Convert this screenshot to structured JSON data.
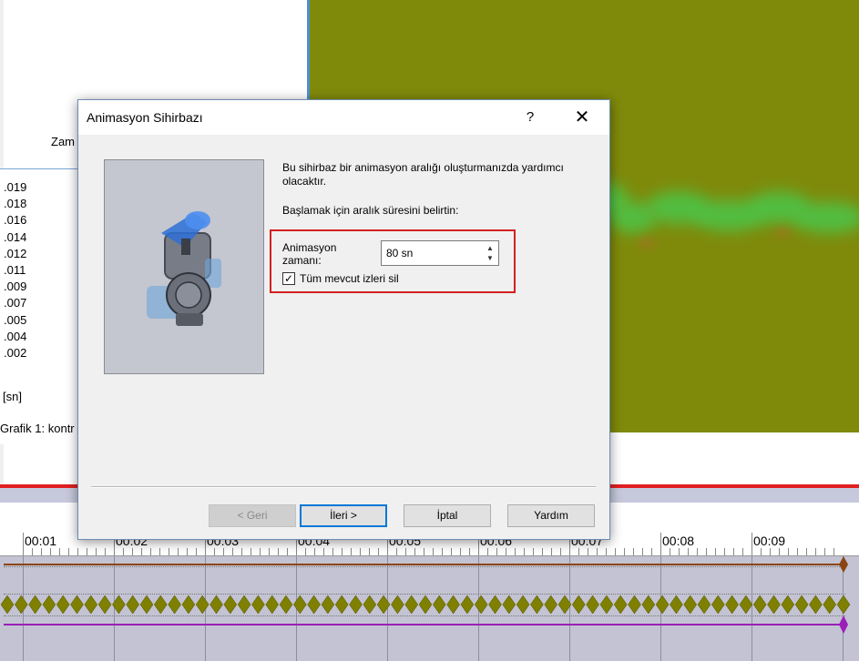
{
  "background_app": {
    "left_panel": {
      "partial_label": "Zam",
      "values": [
        ".019",
        ".018",
        ".016",
        ".014",
        ".012",
        ".011",
        ".009",
        ".007",
        ".005",
        ".004",
        ".002"
      ],
      "unit_label": "[sn]",
      "graph_label": "Grafik 1: kontr"
    },
    "timeline": {
      "labels": [
        "00:01",
        "00:02",
        "00:03",
        "00:04",
        "00:05",
        "00:06",
        "00:07",
        "00:08",
        "00:09"
      ],
      "track_colors": [
        "#8b4513",
        "#7f7f00",
        "#9b1fb8"
      ]
    }
  },
  "dialog": {
    "title": "Animasyon Sihirbazı",
    "help_glyph": "?",
    "close_glyph": "✕",
    "intro_text": "Bu sihirbaz bir animasyon aralığı oluşturmanızda yardımcı olacaktır.",
    "instruction": "Başlamak için aralık süresini belirtin:",
    "animation_time": {
      "label": "Animasyon zamanı:",
      "value": "80 sn"
    },
    "checkbox": {
      "label": "Tüm mevcut izleri sil",
      "checked": true,
      "check_glyph": "✓"
    },
    "buttons": {
      "back": "< Geri",
      "next": "İleri >",
      "cancel": "İptal",
      "help": "Yardım"
    }
  }
}
